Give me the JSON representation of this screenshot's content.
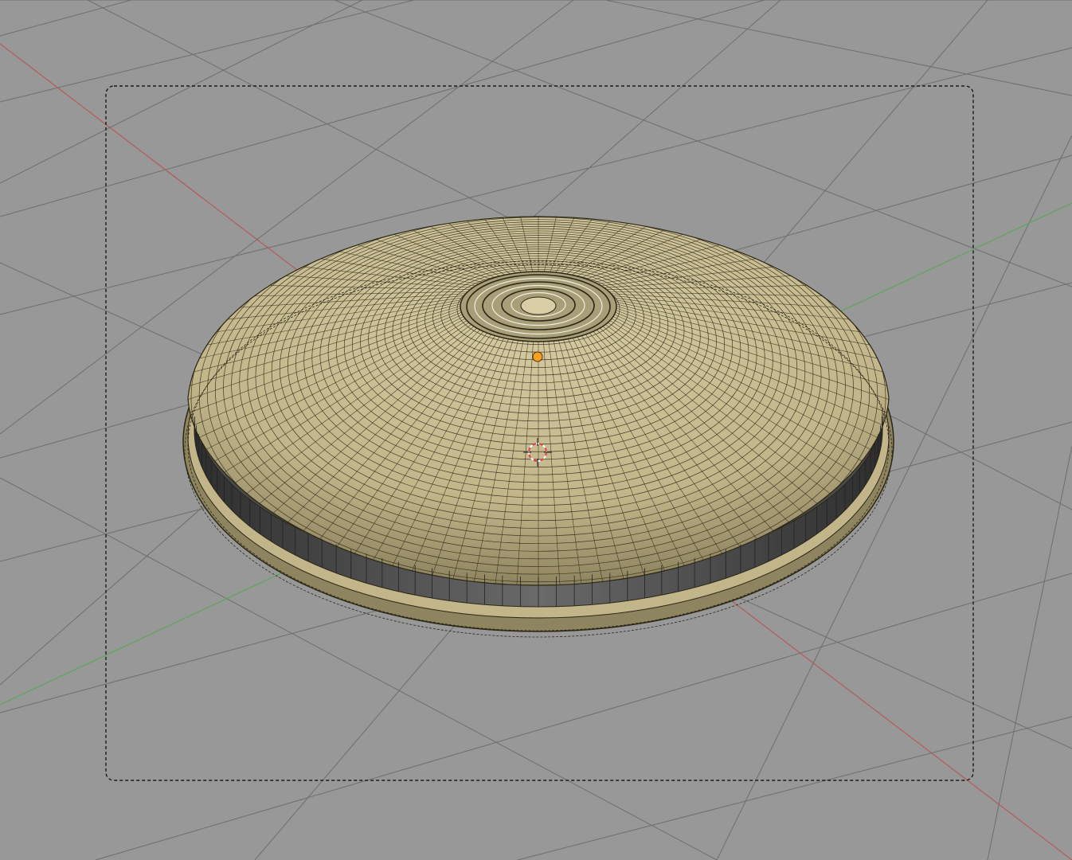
{
  "viewport": {
    "background": "#989898",
    "grid_color": "#6e6e6e",
    "x_axis_color": "#b35a5a",
    "y_axis_color": "#5aa85a",
    "camera_frame_color": "#1a1a1a"
  },
  "mesh": {
    "object_type": "dome-lid",
    "display_mode": "solid-with-wireframe",
    "face_color": "#c2b58a",
    "face_color_dark": "#8e845f",
    "wire_color": "#2b2616",
    "band_color": "#4a4a4a"
  },
  "origin_marker": {
    "color": "#f5a020",
    "icon": "object-origin-dot"
  },
  "cursor_3d": {
    "icon": "3d-cursor-icon",
    "color_a": "#e04040",
    "color_b": "#ffffff"
  }
}
